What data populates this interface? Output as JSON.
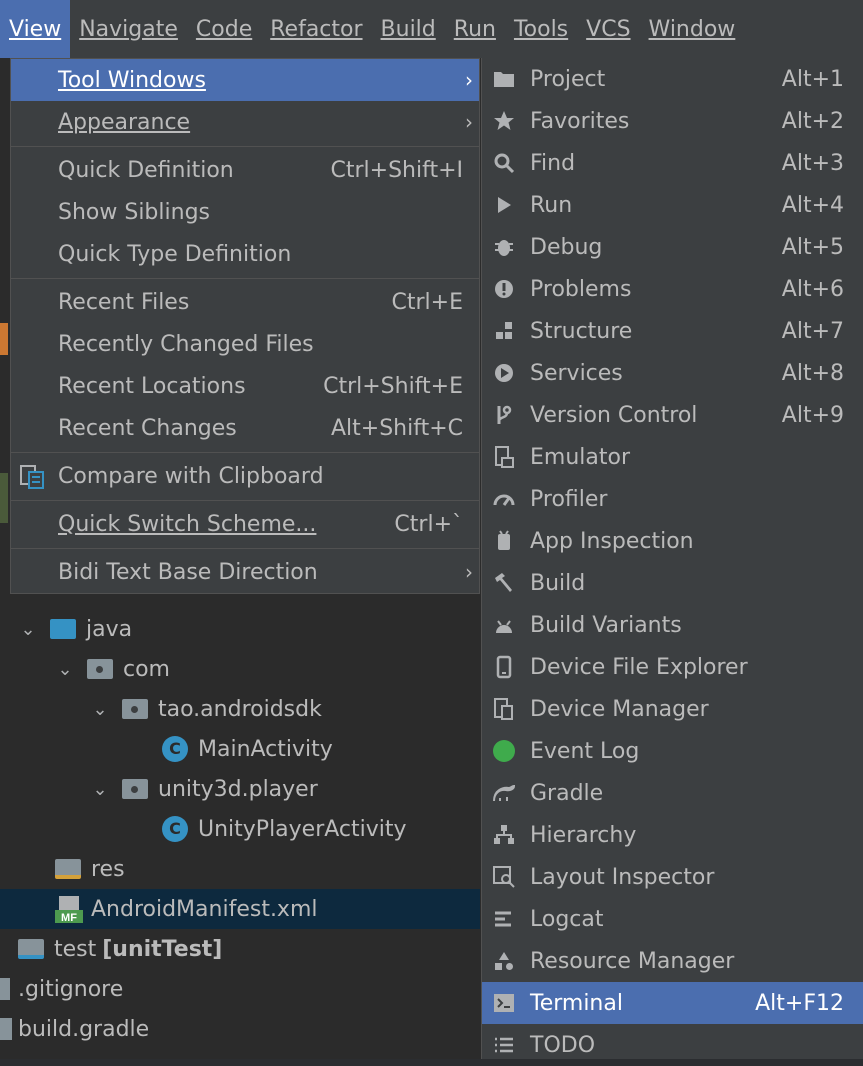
{
  "menubar": {
    "items": [
      {
        "label": "View",
        "u": 0
      },
      {
        "label": "Navigate",
        "u": 0
      },
      {
        "label": "Code",
        "u": 0
      },
      {
        "label": "Refactor",
        "u": 0
      },
      {
        "label": "Build",
        "u": 0
      },
      {
        "label": "Run",
        "u": 1
      },
      {
        "label": "Tools",
        "u": 0
      },
      {
        "label": "VCS",
        "u": 2
      },
      {
        "label": "Window",
        "u": 0
      }
    ]
  },
  "view_menu": {
    "tool_windows": {
      "label": "Tool Windows"
    },
    "appearance": {
      "label": "Appearance"
    },
    "quick_definition": {
      "label": "Quick Definition",
      "shortcut": "Ctrl+Shift+I"
    },
    "show_siblings": {
      "label": "Show Siblings"
    },
    "quick_type_definition": {
      "label": "Quick Type Definition"
    },
    "recent_files": {
      "label": "Recent Files",
      "shortcut": "Ctrl+E"
    },
    "recently_changed_files": {
      "label": "Recently Changed Files"
    },
    "recent_locations": {
      "label": "Recent Locations",
      "shortcut": "Ctrl+Shift+E"
    },
    "recent_changes": {
      "label": "Recent Changes",
      "shortcut": "Alt+Shift+C"
    },
    "compare_clipboard": {
      "label": "Compare with Clipboard"
    },
    "quick_switch": {
      "label": "Quick Switch Scheme...",
      "shortcut": "Ctrl+`"
    },
    "bidi": {
      "label": "Bidi Text Base Direction"
    }
  },
  "tool_windows": {
    "items": [
      {
        "label": "Project",
        "shortcut": "Alt+1",
        "icon": "folder-icon"
      },
      {
        "label": "Favorites",
        "shortcut": "Alt+2",
        "icon": "star-icon"
      },
      {
        "label": "Find",
        "shortcut": "Alt+3",
        "icon": "search-icon"
      },
      {
        "label": "Run",
        "shortcut": "Alt+4",
        "icon": "play-icon"
      },
      {
        "label": "Debug",
        "shortcut": "Alt+5",
        "icon": "bug-icon"
      },
      {
        "label": "Problems",
        "shortcut": "Alt+6",
        "icon": "warning-circle-icon"
      },
      {
        "label": "Structure",
        "shortcut": "Alt+7",
        "icon": "structure-icon"
      },
      {
        "label": "Services",
        "shortcut": "Alt+8",
        "icon": "services-icon"
      },
      {
        "label": "Version Control",
        "shortcut": "Alt+9",
        "icon": "branch-icon"
      },
      {
        "label": "Emulator",
        "shortcut": "",
        "icon": "emulator-icon"
      },
      {
        "label": "Profiler",
        "shortcut": "",
        "icon": "gauge-icon"
      },
      {
        "label": "App Inspection",
        "shortcut": "",
        "icon": "android-inspect-icon"
      },
      {
        "label": "Build",
        "shortcut": "",
        "icon": "hammer-icon"
      },
      {
        "label": "Build Variants",
        "shortcut": "",
        "icon": "android-icon"
      },
      {
        "label": "Device File Explorer",
        "shortcut": "",
        "icon": "phone-icon"
      },
      {
        "label": "Device Manager",
        "shortcut": "",
        "icon": "device-manager-icon"
      },
      {
        "label": "Event Log",
        "shortcut": "",
        "icon": "event-log-icon"
      },
      {
        "label": "Gradle",
        "shortcut": "",
        "icon": "gradle-icon"
      },
      {
        "label": "Hierarchy",
        "shortcut": "",
        "icon": "hierarchy-icon"
      },
      {
        "label": "Layout Inspector",
        "shortcut": "",
        "icon": "layout-inspector-icon"
      },
      {
        "label": "Logcat",
        "shortcut": "",
        "icon": "logcat-icon"
      },
      {
        "label": "Resource Manager",
        "shortcut": "",
        "icon": "resource-manager-icon"
      },
      {
        "label": "Terminal",
        "shortcut": "Alt+F12",
        "icon": "terminal-icon"
      },
      {
        "label": "TODO",
        "shortcut": "",
        "icon": "todo-icon"
      }
    ]
  },
  "tree": {
    "java": "java",
    "com": "com",
    "tao": "tao.androidsdk",
    "main_activity": "MainActivity",
    "unity": "unity3d.player",
    "unity_activity": "UnityPlayerActivity",
    "res": "res",
    "manifest": "AndroidManifest.xml",
    "test": "test",
    "test_tag": "[unitTest]",
    "gitignore": ".gitignore",
    "build_gradle": "build.gradle",
    "class_badge": "C",
    "mf_badge": "MF"
  },
  "colors": {
    "accent": "#4b6eaf",
    "menu_bg": "#3c3f41",
    "tree_bg": "#2b2b2b",
    "selected_row": "#0d293e",
    "folder_blue": "#3592c4"
  }
}
